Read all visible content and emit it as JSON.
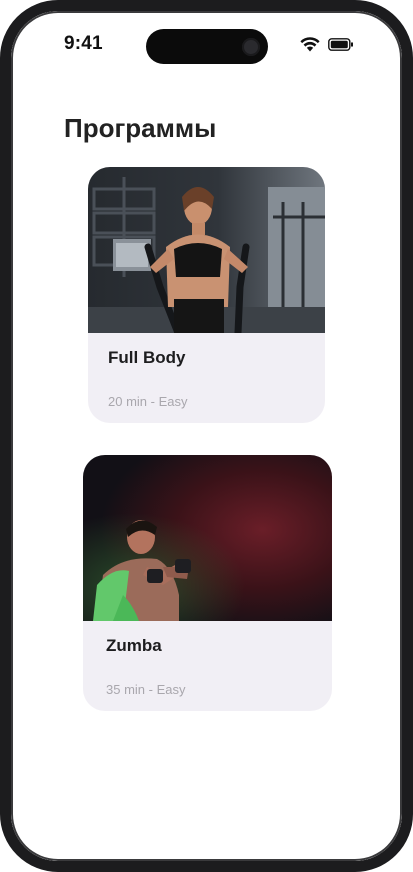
{
  "status_bar": {
    "time": "9:41",
    "icons": [
      "wifi-icon",
      "battery-icon"
    ]
  },
  "page": {
    "title": "Программы"
  },
  "programs": [
    {
      "title": "Full Body",
      "meta": "20 min - Easy",
      "image": "woman-on-elliptical-photo"
    },
    {
      "title": "Zumba",
      "meta": "35 min - Easy",
      "image": "man-boxing-neon-photo"
    }
  ],
  "colors": {
    "background": "#ffffff",
    "card": "#f1eff5",
    "title": "#222222",
    "meta": "#a9a7ad",
    "frame": "#1c1c1e"
  }
}
